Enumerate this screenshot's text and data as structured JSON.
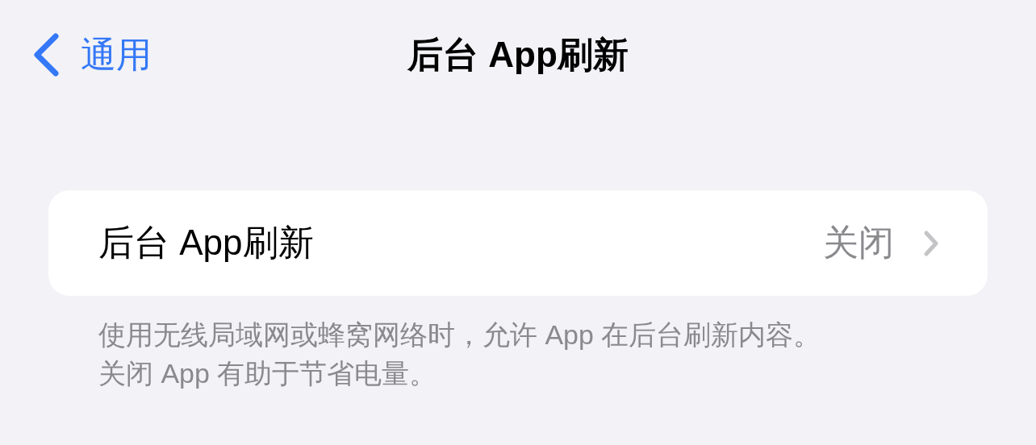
{
  "nav_bar": {
    "back_label": "通用",
    "title": "后台 App刷新"
  },
  "settings_group": {
    "rows": [
      {
        "label": "后台 App刷新",
        "value": "关闭"
      }
    ]
  },
  "footer_lines": [
    "使用无线局域网或蜂窝网络时，允许 App 在后台刷新内容。",
    "关闭 App 有助于节省电量。"
  ]
}
